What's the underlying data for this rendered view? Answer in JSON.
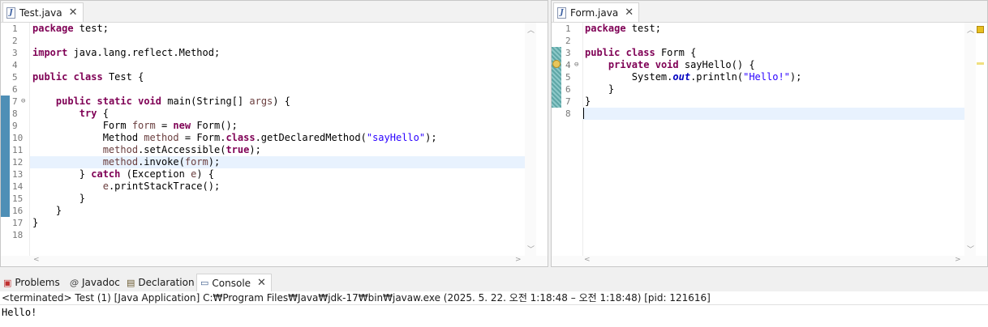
{
  "left_editor": {
    "tab_label": "Test.java",
    "line_numbers": [
      "1",
      "2",
      "3",
      "4",
      "5",
      "6",
      "7",
      "8",
      "9",
      "10",
      "11",
      "12",
      "13",
      "14",
      "15",
      "16",
      "17",
      "18"
    ],
    "code_lines": [
      "package test;",
      "",
      "import java.lang.reflect.Method;",
      "",
      "public class Test {",
      "",
      "    public static void main(String[] args) {",
      "        try {",
      "            Form form = new Form();",
      "            Method method = Form.class.getDeclaredMethod(\"sayHello\");",
      "            method.setAccessible(true);",
      "            method.invoke(form);",
      "        } catch (Exception e) {",
      "            e.printStackTrace();",
      "        }",
      "    }",
      "}",
      ""
    ]
  },
  "right_editor": {
    "tab_label": "Form.java",
    "line_numbers": [
      "1",
      "2",
      "3",
      "4",
      "5",
      "6",
      "7",
      "8"
    ],
    "code_lines": [
      "package test;",
      "",
      "public class Form {",
      "    private void sayHello() {",
      "        System.out.println(\"Hello!\");",
      "    }",
      "}",
      ""
    ]
  },
  "bottom_panel": {
    "tabs": [
      {
        "label": "Problems",
        "icon": "problems-icon"
      },
      {
        "label": "Javadoc",
        "icon": "javadoc-icon"
      },
      {
        "label": "Declaration",
        "icon": "declaration-icon"
      },
      {
        "label": "Console",
        "icon": "console-icon",
        "active": true
      }
    ],
    "console_status": "<terminated> Test (1) [Java Application] C:₩Program Files₩Java₩jdk-17₩bin₩javaw.exe  (2025. 5. 22. 오전 1:18:48 – 오전 1:18:48) [pid: 121616]",
    "console_output": "Hello!"
  },
  "colors": {
    "keyword": "#7f0055",
    "string": "#2a00ff",
    "local_variable": "#6a3e3e",
    "static_field": "#0000c0",
    "current_line": "#e8f2fe",
    "change_marker": "#4e8fb6"
  }
}
